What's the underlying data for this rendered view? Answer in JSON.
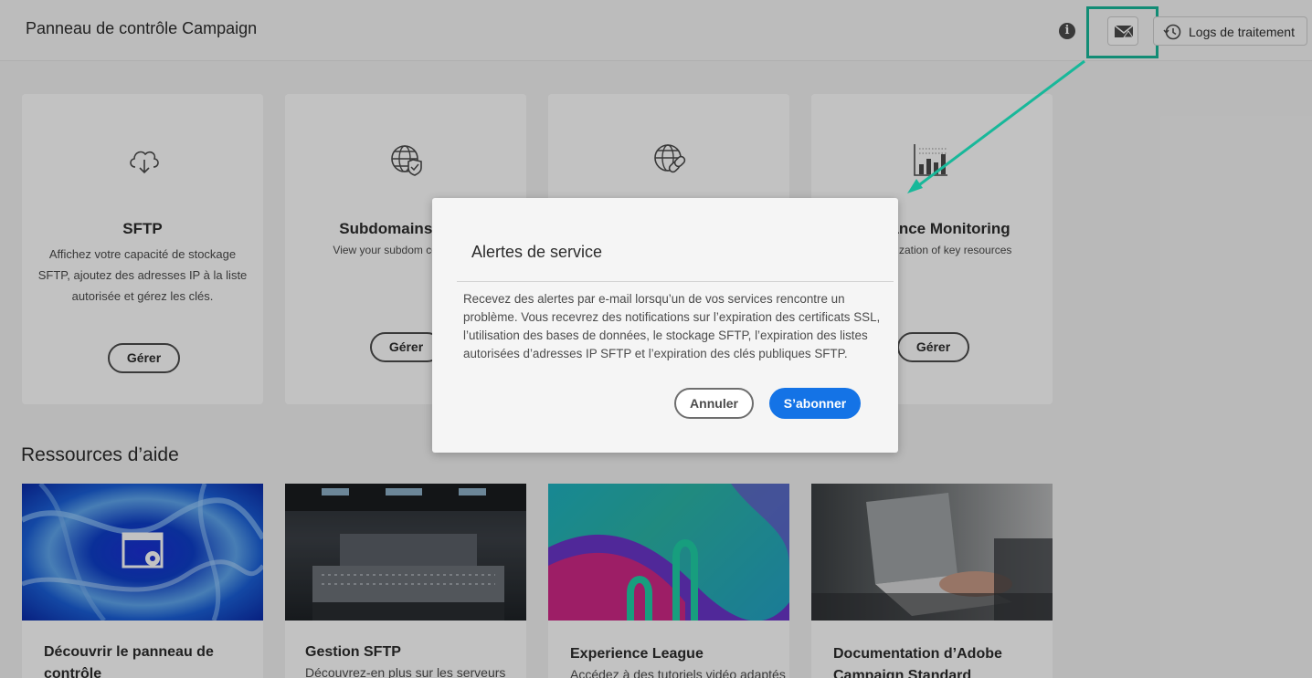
{
  "header": {
    "title": "Panneau de contrôle Campaign",
    "info_icon": "info-icon",
    "service_alerts_icon": "mail-alert-icon",
    "logs_label": "Logs de traitement",
    "logs_icon": "history-clock-icon"
  },
  "cards": [
    {
      "title": "SFTP",
      "description": "Affichez votre capacité de stockage SFTP, ajoutez des adresses IP à la liste autorisée et gérez les clés.",
      "button": "Gérer",
      "icon": "cloud-download-icon"
    },
    {
      "title": "Subdomains & Ce",
      "description": "View your subdom certificates",
      "button": "Gérer",
      "icon": "globe-shield-icon"
    },
    {
      "title": "",
      "description": "",
      "button": "",
      "icon": "globe-link-icon"
    },
    {
      "title": "nance Monitoring",
      "description": "zation of key resources",
      "button": "Gérer",
      "icon": "bar-chart-icon"
    }
  ],
  "resources": {
    "title": "Ressources d’aide",
    "items": [
      {
        "title": "Découvrir le panneau de contrôle",
        "description": ""
      },
      {
        "title": "Gestion SFTP",
        "description": "Découvrez-en plus sur les serveurs"
      },
      {
        "title": "Experience League",
        "description": "Accédez à des tutoriels vidéo adaptés"
      },
      {
        "title": "Documentation d’Adobe Campaign Standard",
        "description": ""
      }
    ]
  },
  "dialog": {
    "title": "Alertes de service",
    "body": "Recevez des alertes par e-mail lorsqu’un de vos services rencontre un problème. Vous recevrez des notifications sur l’expiration des certificats SSL, l’utilisation des bases de données, le stockage SFTP, l’expiration des listes autorisées d’adresses IP SFTP et l’expiration des clés publiques SFTP.",
    "cancel_label": "Annuler",
    "subscribe_label": "S’abonner"
  },
  "colors": {
    "accent": "#1473e6",
    "highlight": "#18b89a",
    "overlay": "rgba(0,0,0,0.24)"
  }
}
